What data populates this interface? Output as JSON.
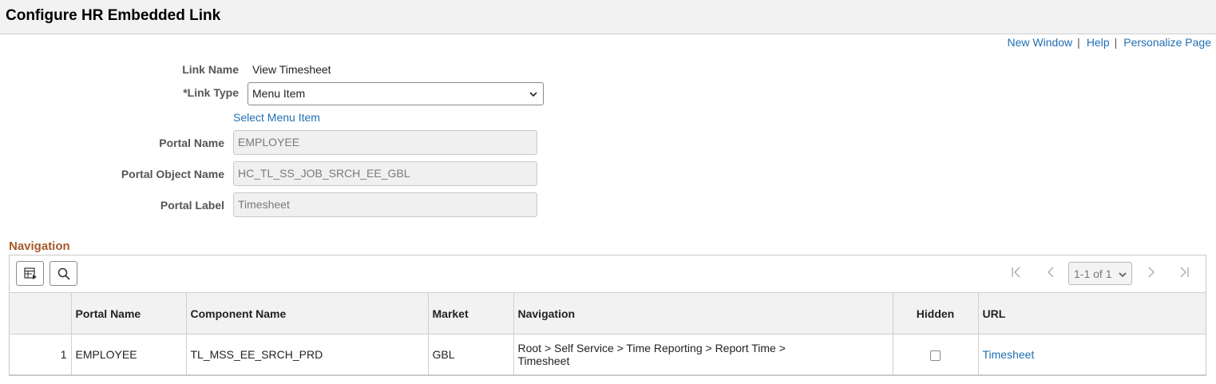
{
  "page": {
    "title": "Configure HR Embedded Link"
  },
  "toplinks": {
    "new_window": "New Window",
    "help": "Help",
    "personalize": "Personalize Page",
    "sep": "|"
  },
  "form": {
    "link_name_label": "Link Name",
    "link_name_value": "View Timesheet",
    "link_type_label": "*Link Type",
    "link_type_value": "Menu Item",
    "select_menu_item": "Select Menu Item",
    "portal_name_label": "Portal Name",
    "portal_name_value": "EMPLOYEE",
    "portal_object_label": "Portal Object Name",
    "portal_object_value": "HC_TL_SS_JOB_SRCH_EE_GBL",
    "portal_label_label": "Portal Label",
    "portal_label_value": "Timesheet"
  },
  "navigation": {
    "title": "Navigation",
    "pager_text": "1-1 of 1",
    "columns": [
      "",
      "Portal Name",
      "Component Name",
      "Market",
      "Navigation",
      "Hidden",
      "URL"
    ],
    "rows": [
      {
        "num": "1",
        "portal_name": "EMPLOYEE",
        "component": "TL_MSS_EE_SRCH_PRD",
        "market": "GBL",
        "nav_line1": "Root > Self Service > Time Reporting > Report Time >",
        "nav_line2": "Timesheet",
        "hidden": false,
        "url": "Timesheet"
      }
    ]
  },
  "icons": {
    "grid_view": "grid-view-icon",
    "search": "search-icon",
    "first": "first-page-icon",
    "prev": "previous-page-icon",
    "next": "next-page-icon",
    "last": "last-page-icon"
  },
  "colors": {
    "link": "#1f6fb2",
    "section": "#a45a2a",
    "header_bg": "#f2f2f2"
  }
}
